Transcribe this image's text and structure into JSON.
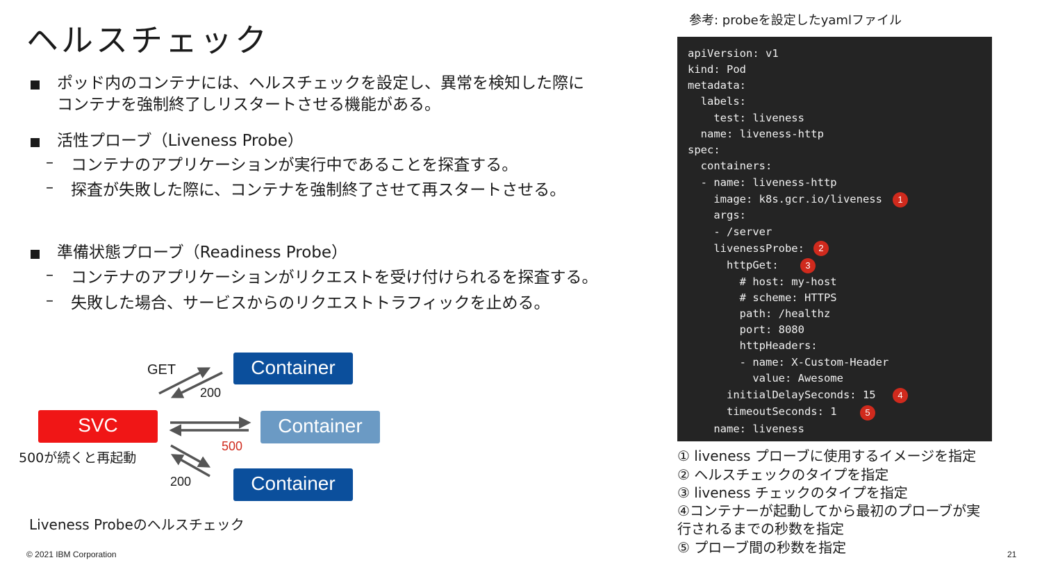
{
  "title": "ヘルスチェック",
  "bullets": [
    {
      "line1": "ポッド内のコンテナには、ヘルスチェックを設定し、異常を検知した際に",
      "line2": "コンテナを強制終了しリスタートさせる機能がある。"
    },
    {
      "heading": "活性プローブ（Liveness Probe）",
      "subs": [
        "コンテナのアプリケーションが実行中であることを探査する。",
        "探査が失敗した際に、コンテナを強制終了させて再スタートさせる。"
      ]
    },
    {
      "heading": "準備状態プローブ（Readiness Probe）",
      "subs": [
        "コンテナのアプリケーションがリクエストを受け付けられるを探査する。",
        "失敗した場合、サービスからのリクエストトラフィックを止める。"
      ]
    }
  ],
  "dash": "–",
  "diagram": {
    "svc": "SVC",
    "containers": [
      "Container",
      "Container",
      "Container"
    ],
    "get": "GET",
    "code_top": "200",
    "code_mid": "500",
    "code_bottom": "200",
    "restart_note": "500が続くと再起動",
    "caption": "Liveness Probeのヘルスチェック",
    "colors": {
      "svc": "#f01616",
      "container_dark": "#0b4f9c",
      "container_light": "#6b9ac4",
      "error": "#d02a1d"
    }
  },
  "reference_label": "参考: probeを設定したyamlファイル",
  "yaml_lines": [
    "apiVersion: v1",
    "kind: Pod",
    "metadata:",
    "  labels:",
    "    test: liveness",
    "  name: liveness-http",
    "spec:",
    "  containers:",
    "  - name: liveness-http",
    "    image: k8s.gcr.io/liveness",
    "    args:",
    "    - /server",
    "    livenessProbe:",
    "      httpGet:",
    "        # host: my-host",
    "        # scheme: HTTPS",
    "        path: /healthz",
    "        port: 8080",
    "        httpHeaders:",
    "        - name: X-Custom-Header",
    "          value: Awesome",
    "      initialDelaySeconds: 15",
    "      timeoutSeconds: 1",
    "    name: liveness"
  ],
  "badges": [
    "1",
    "2",
    "3",
    "4",
    "5"
  ],
  "notes": [
    "① liveness プローブに使用するイメージを指定",
    "② ヘルスチェックのタイプを指定",
    "③ liveness チェックのタイプを指定",
    "④コンテナーが起動してから最初のプローブが実",
    "行されるまでの秒数を指定",
    "⑤ プローブ間の秒数を指定"
  ],
  "footer": {
    "copyright": "© 2021 IBM Corporation",
    "page": "21"
  }
}
